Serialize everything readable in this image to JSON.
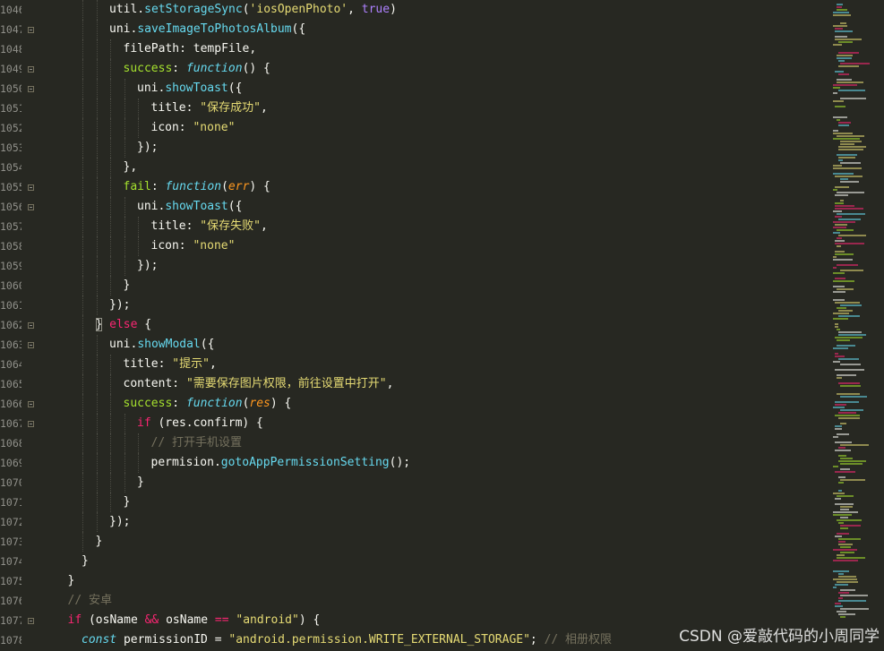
{
  "editor": {
    "lines": [
      {
        "num": "1046",
        "fold": false,
        "tokens": [
          [
            "t",
            "util."
          ],
          [
            "fn",
            "setStorageSync"
          ],
          [
            "t",
            "("
          ],
          [
            "st",
            "'iosOpenPhoto'"
          ],
          [
            "t",
            ", "
          ],
          [
            "bool",
            "true"
          ],
          [
            "t",
            ")"
          ]
        ]
      },
      {
        "num": "1047",
        "fold": true,
        "tokens": [
          [
            "t",
            "uni."
          ],
          [
            "fn",
            "saveImageToPhotosAlbum"
          ],
          [
            "t",
            "({"
          ]
        ]
      },
      {
        "num": "1048",
        "fold": false,
        "tokens": [
          [
            "t",
            "filePath: tempFile,"
          ]
        ]
      },
      {
        "num": "1049",
        "fold": true,
        "tokens": [
          [
            "prop",
            "success"
          ],
          [
            "t",
            ": "
          ],
          [
            "sf",
            "function"
          ],
          [
            "t",
            "() {"
          ]
        ]
      },
      {
        "num": "1050",
        "fold": true,
        "tokens": [
          [
            "t",
            "uni."
          ],
          [
            "fn",
            "showToast"
          ],
          [
            "t",
            "({"
          ]
        ]
      },
      {
        "num": "1051",
        "fold": false,
        "tokens": [
          [
            "t",
            "title: "
          ],
          [
            "st",
            "\"保存成功\""
          ],
          [
            "t",
            ","
          ]
        ]
      },
      {
        "num": "1052",
        "fold": false,
        "tokens": [
          [
            "t",
            "icon: "
          ],
          [
            "st",
            "\"none\""
          ]
        ]
      },
      {
        "num": "1053",
        "fold": false,
        "tokens": [
          [
            "t",
            "});"
          ]
        ]
      },
      {
        "num": "1054",
        "fold": false,
        "tokens": [
          [
            "t",
            "},"
          ]
        ]
      },
      {
        "num": "1055",
        "fold": true,
        "tokens": [
          [
            "prop",
            "fail"
          ],
          [
            "t",
            ": "
          ],
          [
            "sf",
            "function"
          ],
          [
            "t",
            "("
          ],
          [
            "pa",
            "err"
          ],
          [
            "t",
            ") {"
          ]
        ]
      },
      {
        "num": "1056",
        "fold": true,
        "tokens": [
          [
            "t",
            "uni."
          ],
          [
            "fn",
            "showToast"
          ],
          [
            "t",
            "({"
          ]
        ]
      },
      {
        "num": "1057",
        "fold": false,
        "tokens": [
          [
            "t",
            "title: "
          ],
          [
            "st",
            "\"保存失败\""
          ],
          [
            "t",
            ","
          ]
        ]
      },
      {
        "num": "1058",
        "fold": false,
        "tokens": [
          [
            "t",
            "icon: "
          ],
          [
            "st",
            "\"none\""
          ]
        ]
      },
      {
        "num": "1059",
        "fold": false,
        "tokens": [
          [
            "t",
            "});"
          ]
        ]
      },
      {
        "num": "1060",
        "fold": false,
        "tokens": [
          [
            "t",
            "}"
          ]
        ]
      },
      {
        "num": "1061",
        "fold": false,
        "tokens": [
          [
            "t",
            "});"
          ]
        ]
      },
      {
        "num": "1062",
        "fold": true,
        "tokens": [
          [
            "brk",
            "}"
          ],
          [
            "t",
            " "
          ],
          [
            "kw",
            "else"
          ],
          [
            "t",
            " {"
          ]
        ]
      },
      {
        "num": "1063",
        "fold": true,
        "tokens": [
          [
            "t",
            "uni."
          ],
          [
            "fn",
            "showModal"
          ],
          [
            "t",
            "({"
          ]
        ]
      },
      {
        "num": "1064",
        "fold": false,
        "tokens": [
          [
            "t",
            "title: "
          ],
          [
            "st",
            "\"提示\""
          ],
          [
            "t",
            ","
          ]
        ]
      },
      {
        "num": "1065",
        "fold": false,
        "tokens": [
          [
            "t",
            "content: "
          ],
          [
            "st",
            "\"需要保存图片权限，前往设置中打开\""
          ],
          [
            "t",
            ","
          ]
        ]
      },
      {
        "num": "1066",
        "fold": true,
        "tokens": [
          [
            "prop",
            "success"
          ],
          [
            "t",
            ": "
          ],
          [
            "sf",
            "function"
          ],
          [
            "t",
            "("
          ],
          [
            "pa",
            "res"
          ],
          [
            "t",
            ") {"
          ]
        ]
      },
      {
        "num": "1067",
        "fold": true,
        "tokens": [
          [
            "kw",
            "if"
          ],
          [
            "t",
            " (res.confirm) {"
          ]
        ]
      },
      {
        "num": "1068",
        "fold": false,
        "tokens": [
          [
            "cm",
            "// 打开手机设置"
          ]
        ]
      },
      {
        "num": "1069",
        "fold": false,
        "tokens": [
          [
            "t",
            "permision."
          ],
          [
            "fn",
            "gotoAppPermissionSetting"
          ],
          [
            "t",
            "();"
          ]
        ]
      },
      {
        "num": "1070",
        "fold": false,
        "tokens": [
          [
            "t",
            "}"
          ]
        ]
      },
      {
        "num": "1071",
        "fold": false,
        "tokens": [
          [
            "t",
            "}"
          ]
        ]
      },
      {
        "num": "1072",
        "fold": false,
        "tokens": [
          [
            "t",
            "});"
          ]
        ]
      },
      {
        "num": "1073",
        "fold": false,
        "tokens": [
          [
            "t",
            "}"
          ]
        ]
      },
      {
        "num": "1074",
        "fold": false,
        "tokens": [
          [
            "t",
            "}"
          ]
        ]
      },
      {
        "num": "1075",
        "fold": false,
        "tokens": [
          [
            "t",
            "}"
          ]
        ]
      },
      {
        "num": "1076",
        "fold": false,
        "tokens": [
          [
            "cm",
            "// 安卓"
          ]
        ]
      },
      {
        "num": "1077",
        "fold": true,
        "tokens": [
          [
            "kw",
            "if"
          ],
          [
            "t",
            " (osName "
          ],
          [
            "kw",
            "&&"
          ],
          [
            "t",
            " osName "
          ],
          [
            "kw",
            "=="
          ],
          [
            "t",
            " "
          ],
          [
            "st",
            "\"android\""
          ],
          [
            "t",
            ") {"
          ]
        ]
      },
      {
        "num": "1078",
        "fold": false,
        "tokens": [
          [
            "sf",
            "const"
          ],
          [
            "t",
            " permissionID = "
          ],
          [
            "st",
            "\"android.permission.WRITE_EXTERNAL_STORAGE\""
          ],
          [
            "t",
            "; "
          ],
          [
            "cm",
            "// 相册权限"
          ]
        ]
      }
    ]
  },
  "colors": {
    "background": "#272822",
    "text": "#f8f8f2",
    "function": "#66d9ef",
    "string": "#e6db74",
    "keyword": "#f92672",
    "boolean": "#ae81ff",
    "property": "#a6e22e",
    "parameter": "#fd971f",
    "comment": "#75715e",
    "line_number": "#90908a"
  },
  "icons": {
    "fold": "fold-toggle-icon"
  },
  "watermark": "CSDN @爱敲代码的小周同学"
}
